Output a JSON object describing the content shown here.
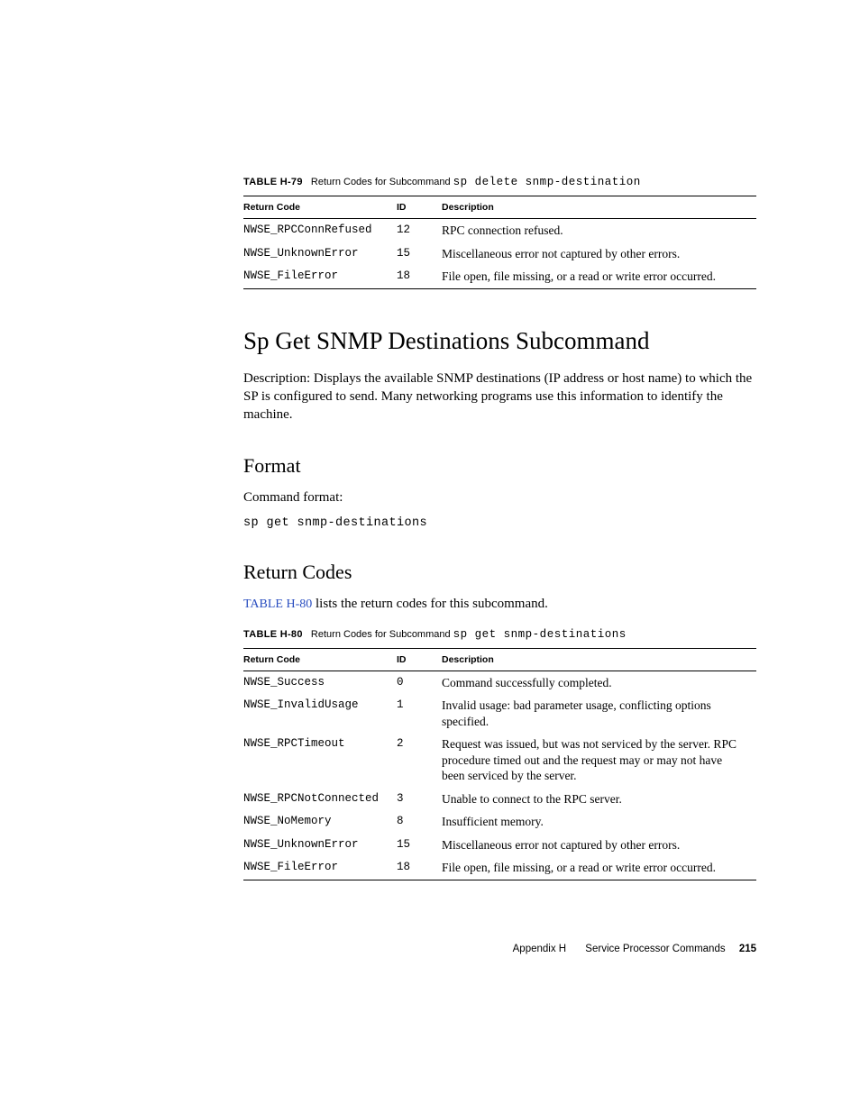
{
  "table79": {
    "caption_label": "TABLE H-79",
    "caption_text": "Return Codes for Subcommand ",
    "caption_cmd": "sp delete snmp-destination",
    "headers": {
      "c1": "Return Code",
      "c2": "ID",
      "c3": "Description"
    },
    "rows": [
      {
        "code": "NWSE_RPCConnRefused",
        "id": "12",
        "desc": "RPC connection refused."
      },
      {
        "code": "NWSE_UnknownError",
        "id": "15",
        "desc": "Miscellaneous error not captured by other errors."
      },
      {
        "code": "NWSE_FileError",
        "id": "18",
        "desc": "File open, file missing, or a read or write error occurred."
      }
    ]
  },
  "section": {
    "title": "Sp Get SNMP Destinations Subcommand",
    "desc": "Description: Displays the available SNMP destinations (IP address or host name) to which the SP is configured to send. Many networking programs use this information to identify the machine."
  },
  "format": {
    "heading": "Format",
    "label": "Command format:",
    "cmd": "sp get snmp-destinations"
  },
  "return_codes": {
    "heading": "Return Codes",
    "link_text": "TABLE H-80",
    "sentence_rest": " lists the return codes for this subcommand."
  },
  "table80": {
    "caption_label": "TABLE H-80",
    "caption_text": "Return Codes for Subcommand ",
    "caption_cmd": "sp get snmp-destinations",
    "headers": {
      "c1": "Return Code",
      "c2": "ID",
      "c3": "Description"
    },
    "rows": [
      {
        "code": "NWSE_Success",
        "id": "0",
        "desc": "Command successfully completed."
      },
      {
        "code": "NWSE_InvalidUsage",
        "id": "1",
        "desc": "Invalid usage: bad parameter usage, conflicting options specified."
      },
      {
        "code": "NWSE_RPCTimeout",
        "id": "2",
        "desc": "Request was issued, but was not serviced by the server. RPC procedure timed out and the request may or may not have been serviced by the server."
      },
      {
        "code": "NWSE_RPCNotConnected",
        "id": "3",
        "desc": "Unable to connect to the RPC server."
      },
      {
        "code": "NWSE_NoMemory",
        "id": "8",
        "desc": "Insufficient memory."
      },
      {
        "code": "NWSE_UnknownError",
        "id": "15",
        "desc": "Miscellaneous error not captured by other errors."
      },
      {
        "code": "NWSE_FileError",
        "id": "18",
        "desc": "File open, file missing, or a read or write error occurred."
      }
    ]
  },
  "footer": {
    "chapter": "Appendix H",
    "title": "Service Processor Commands",
    "page": "215"
  }
}
